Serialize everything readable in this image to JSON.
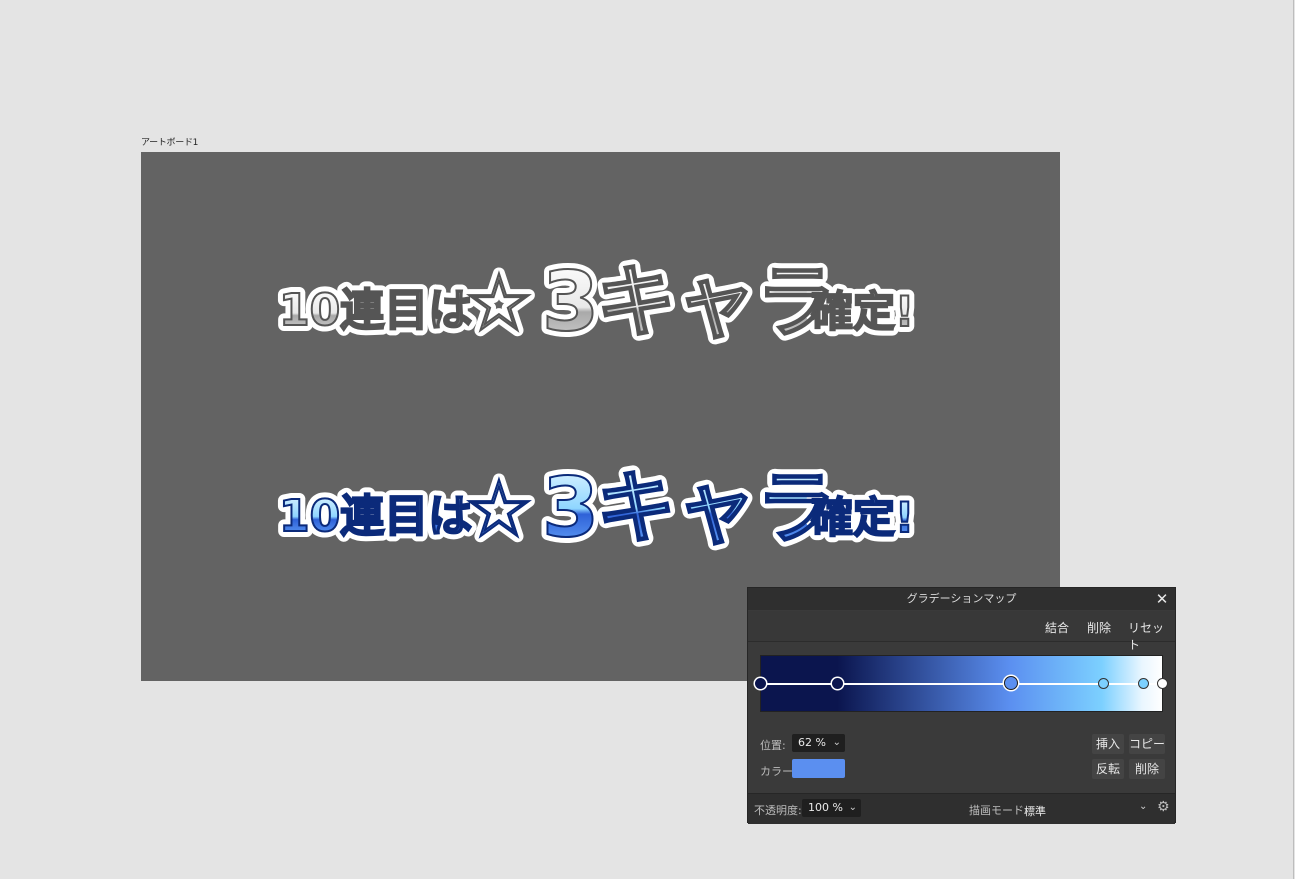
{
  "artboard": {
    "label": "アートボード1",
    "headline": {
      "part1": "10連目は",
      "star": "☆",
      "digit": "3",
      "part2": "キャラ",
      "part3": "確定!"
    }
  },
  "panel": {
    "title": "グラデーションマップ",
    "close_icon": "✕",
    "top_actions": {
      "merge": "結合",
      "delete": "削除",
      "reset": "リセット"
    },
    "gradient": {
      "stops_percent": [
        0,
        19,
        62,
        85,
        95,
        100
      ],
      "stop_colors": [
        "#0b154e",
        "#0b154e",
        "#5b8ff0",
        "#7cd0ff",
        "#e9f6ff",
        "#ffffff"
      ],
      "selected_index": 2
    },
    "position_label": "位置:",
    "position_value": "62 %",
    "color_label": "カラー:",
    "color_value": "#5b8ff0",
    "buttons": {
      "insert": "挿入",
      "copy": "コピー",
      "invert": "反転",
      "delete": "削除"
    },
    "opacity_label": "不透明度:",
    "opacity_value": "100 %",
    "blend_label": "描画モード:",
    "blend_value": "標準"
  },
  "colors": {
    "canvas_bg": "#e4e4e4",
    "artboard_bg": "#636363",
    "panel_bg": "#3a3a3a",
    "accent": "#5b8ff0"
  }
}
